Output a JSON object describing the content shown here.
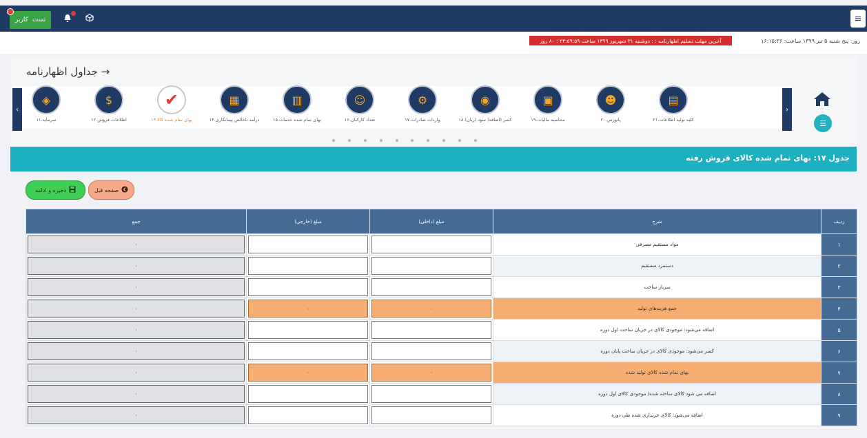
{
  "topbar": {
    "user_label": "کاربر",
    "test_label": "تست",
    "menu_icon": "hamburger-icon",
    "bell_icon": "bell-icon",
    "cube_icon": "cube-icon"
  },
  "info": {
    "date_text": "روز: پنج شنبه ۵ تیر ۱۳۹۹ ساعت: ۱۶:۱۵:۳۶",
    "deadline_text": "آخرین مهلت تسلیم اظهارنامه : : دوشنبه ۳۱ شهریور ۱۳۹۹ ساعت ۲۳:۵۹:۵۹ : ۸۰ روز"
  },
  "page": {
    "title": "جداول اظهارنامه",
    "back_arrow": "→"
  },
  "steps": [
    {
      "label": "۲۱.کلیه تولید اطلاعات",
      "icon": "documents-icon"
    },
    {
      "label": "۲۰.پاتورس",
      "icon": "people-icon"
    },
    {
      "label": "۱۹.محاسبه مالیات",
      "icon": "monitor-icon"
    },
    {
      "label": "۱۸.کسر (اضافه) سود (زیان)",
      "icon": "money-icon"
    },
    {
      "label": "۱۷.واردات صادرات",
      "icon": "gears-icon"
    },
    {
      "label": "۱۶.تعداد کارکنان",
      "icon": "staff-icon"
    },
    {
      "label": "۱۵.بهای تمام شده خدمات",
      "icon": "city-icon"
    },
    {
      "label": "۱۴.درآمد ناخالص پیمانکاری",
      "icon": "report-icon"
    },
    {
      "label": "۱۳.بهای تمام شده کالا",
      "icon": "checkmark-icon",
      "active": true
    },
    {
      "label": "۱۲.اطلاعات فروش",
      "icon": "sales-icon"
    },
    {
      "label": "۱۱.سرمایه",
      "icon": "capital-icon"
    }
  ],
  "section": {
    "title": "جدول ۱۷: بهای تمام شده کالای فروش رفته"
  },
  "buttons": {
    "save_label": "ذخیره و ادامه",
    "prev_label": "صفحه قبل"
  },
  "table": {
    "headers": {
      "row": "ردیف",
      "description": "شرح",
      "amount_internal": "مبلغ (داخلی)",
      "amount_external": "مبلغ (خارجی)",
      "total": "جمع"
    },
    "rows": [
      {
        "n": "۱",
        "desc": "مواد مستقیم مصرفی",
        "internal": "",
        "external": "",
        "total": "۰"
      },
      {
        "n": "۲",
        "desc": "دستمزد مستقیم",
        "internal": "",
        "external": "",
        "total": "۰"
      },
      {
        "n": "۳",
        "desc": "سربار ساخت",
        "internal": "",
        "external": "",
        "total": "۰"
      },
      {
        "n": "۴",
        "desc": "جمع هزینه‌های تولید",
        "internal": "۰",
        "external": "۰",
        "total": "۰",
        "highlight": true
      },
      {
        "n": "۵",
        "desc": "اضافه می‌شود: موجودی کالای در جریان ساخت اول دوره",
        "internal": "",
        "external": "",
        "total": "۰"
      },
      {
        "n": "۶",
        "desc": "کسر می‌شود: موجودی کالای در جریان ساخت پایان دوره",
        "internal": "",
        "external": "",
        "total": "۰"
      },
      {
        "n": "۷",
        "desc": "بهای تمام شده کالای تولید شده",
        "internal": "۰",
        "external": "۰",
        "total": "۰",
        "highlight": true
      },
      {
        "n": "۸",
        "desc": "اضافه می شود کالای ساخته شده/ موجودی کالای اول دوره",
        "internal": "",
        "external": "",
        "total": "۰"
      },
      {
        "n": "۹",
        "desc": "اضافه می‌شود: کالای خریداری شده طی دوره",
        "internal": "",
        "external": "",
        "total": "۰"
      }
    ]
  }
}
